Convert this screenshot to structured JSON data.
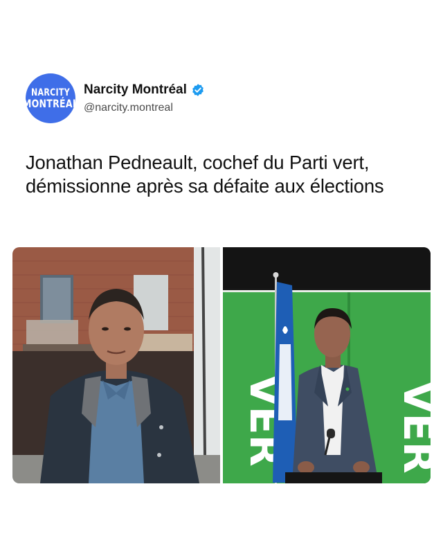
{
  "post": {
    "account": {
      "display_name": "Narcity Montréal",
      "handle": "@narcity.montreal",
      "verified": true,
      "avatar": {
        "line1": "NARCITY",
        "line2": "MONTRÉAL",
        "color": "#3f6ee8"
      }
    },
    "headline": "Jonathan Pedneault, cochef du Parti vert, démissionne après sa défaite aux élections",
    "images": [
      {
        "icon": "portrait-photo",
        "description_name": "man-outdoors-photo"
      },
      {
        "icon": "podium-photo",
        "banner_text": "VER",
        "banner_text_right": "VER",
        "background_color": "#3ea84a"
      }
    ],
    "colors": {
      "verified_badge": "#1d9bf0",
      "brand_green": "#3ea84a"
    }
  }
}
